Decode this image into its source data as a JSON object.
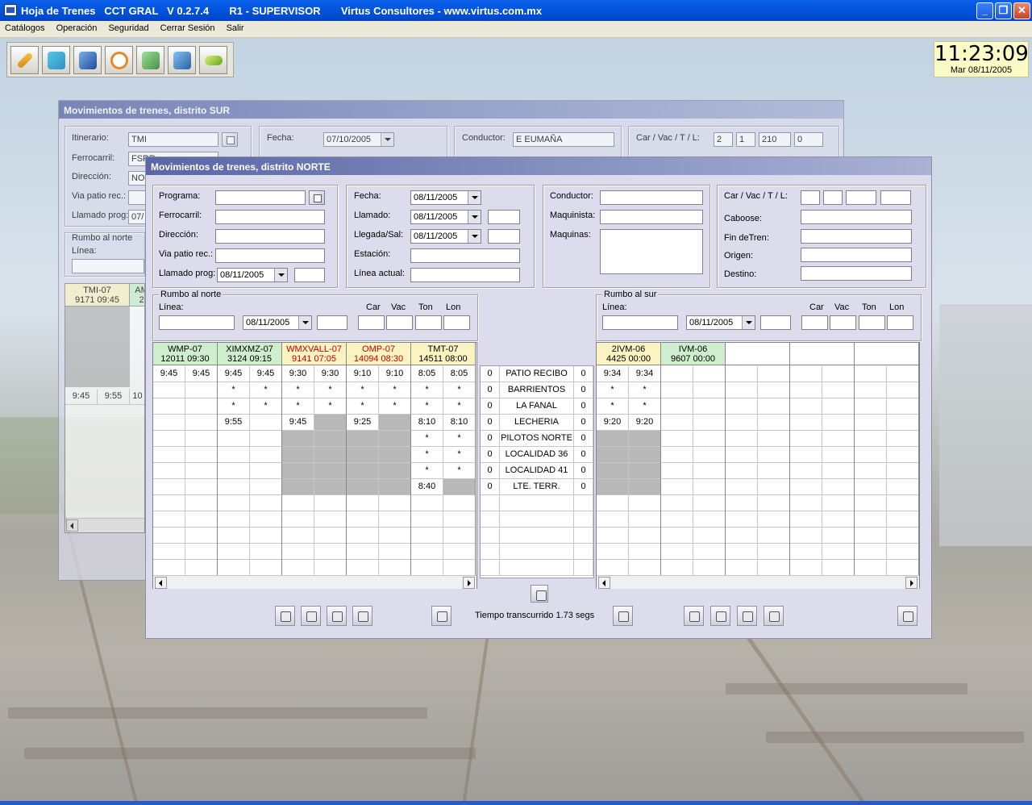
{
  "app": {
    "title": "Hoja de Trenes   CCT GRAL   V 0.2.7.4       R1 - SUPERVISOR       Virtus Consultores - www.virtus.com.mx"
  },
  "menu": [
    "Catálogos",
    "Operación",
    "Seguridad",
    "Cerrar Sesión",
    "Salir"
  ],
  "toolbar": [
    "pencil-icon",
    "export-icon",
    "books-icon",
    "clock-icon",
    "device-icon",
    "book-icon",
    "battery-icon"
  ],
  "clock": {
    "time": "11:23:09",
    "date": "Mar 08/11/2005"
  },
  "sur": {
    "title": "Movimientos de trenes, distrito SUR",
    "labels": {
      "itinerario": "Itinerario:",
      "ferrocarril": "Ferrocarril:",
      "direccion": "Dirección:",
      "via": "Via patio rec.:",
      "llamado_prog": "Llamado prog:",
      "fecha": "Fecha:",
      "conductor": "Conductor:",
      "car": "Car / Vac / T / L:",
      "rumbo": "Rumbo al norte",
      "linea": "Línea:"
    },
    "values": {
      "itinerario": "TMI",
      "ferrocarril": "FSRR",
      "direccion": "NO",
      "llamado_prog": "07/",
      "fecha": "07/10/2005",
      "conductor": "E EUMAÑA",
      "car": "2",
      "vac": "1",
      "ton": "210",
      "lon": "0"
    },
    "headers": [
      {
        "name": "TMI-07",
        "sub": "9171 09:45"
      },
      {
        "name": "AM",
        "sub": "2"
      }
    ],
    "row": [
      "9:45",
      "9:55",
      "10"
    ]
  },
  "norte": {
    "title": "Movimientos de trenes, distrito NORTE",
    "labels": {
      "programa": "Programa:",
      "ferrocarril": "Ferrocarril:",
      "direccion": "Dirección:",
      "via": "Via patio rec.:",
      "llamado_prog": "Llamado prog:",
      "fecha": "Fecha:",
      "llamado": "Llamado:",
      "llegada": "Llegada/Sal:",
      "estacion": "Estación:",
      "linea_actual": "Línea actual:",
      "conductor": "Conductor:",
      "maquinista": "Maquinista:",
      "maquinas": "Maquinas:",
      "car": "Car / Vac / T / L:",
      "caboose": "Caboose:",
      "fin_tren": "Fin deTren:",
      "origen": "Origen:",
      "destino": "Destino:",
      "rumbo_norte": "Rumbo al norte",
      "rumbo_sur": "Rumbo al sur",
      "linea": "Línea:",
      "car_h": "Car",
      "vac_h": "Vac",
      "ton_h": "Ton",
      "lon_h": "Lon"
    },
    "values": {
      "llamado_prog": "08/11/2005",
      "fecha": "08/11/2005",
      "llamado": "08/11/2005",
      "llegada": "08/11/2005",
      "norte_fecha": "08/11/2005",
      "sur_fecha": "08/11/2005"
    },
    "status": "Tiempo transcurrido 1.73 segs",
    "north_trains": [
      {
        "name": "WMP-07",
        "sub": "12011 09:30",
        "color": "#cfeecd",
        "text": "#000"
      },
      {
        "name": "XIMXMZ-07",
        "sub": "3124 09:15",
        "color": "#cfeecd",
        "text": "#000"
      },
      {
        "name": "WMXVALL-07",
        "sub": "9141 07:05",
        "color": "#fbf3c2",
        "text": "#c00000"
      },
      {
        "name": "OMP-07",
        "sub": "14094 08:30",
        "color": "#fbf3c2",
        "text": "#c00000"
      },
      {
        "name": "TMT-07",
        "sub": "14511 08:00",
        "color": "#fbf3c2",
        "text": "#000"
      }
    ],
    "north_rows": [
      [
        "9:45",
        "9:45",
        "9:45",
        "9:45",
        "9:30",
        "9:30",
        "9:10",
        "9:10",
        "8:05",
        "8:05"
      ],
      [
        "",
        "",
        "*",
        "*",
        "*",
        "*",
        "*",
        "*",
        "*",
        "*"
      ],
      [
        "",
        "",
        "*",
        "*",
        "*",
        "*",
        "*",
        "*",
        "*",
        "*"
      ],
      [
        "",
        "",
        "9:55",
        "",
        "9:45",
        "G",
        "9:25",
        "G",
        "8:10",
        "8:10"
      ],
      [
        "",
        "",
        "",
        "",
        "G",
        "G",
        "G",
        "G",
        "*",
        "*"
      ],
      [
        "",
        "",
        "",
        "",
        "G",
        "G",
        "G",
        "G",
        "*",
        "*"
      ],
      [
        "",
        "",
        "",
        "",
        "G",
        "G",
        "G",
        "G",
        "*",
        "*"
      ],
      [
        "",
        "",
        "",
        "",
        "G",
        "G",
        "G",
        "G",
        "8:40",
        "G"
      ]
    ],
    "stations": [
      {
        "l": "0",
        "name": "PATIO RECIBO",
        "r": "0"
      },
      {
        "l": "0",
        "name": "BARRIENTOS",
        "r": "0"
      },
      {
        "l": "0",
        "name": "LA FANAL",
        "r": "0"
      },
      {
        "l": "0",
        "name": "LECHERIA",
        "r": "0"
      },
      {
        "l": "0",
        "name": "PILOTOS NORTE",
        "r": "0"
      },
      {
        "l": "0",
        "name": "LOCALIDAD 36",
        "r": "0"
      },
      {
        "l": "0",
        "name": "LOCALIDAD 41",
        "r": "0"
      },
      {
        "l": "0",
        "name": "LTE. TERR.",
        "r": "0"
      }
    ],
    "south_trains": [
      {
        "name": "2IVM-06",
        "sub": "4425 00:00",
        "color": "#fbf3c2",
        "text": "#000"
      },
      {
        "name": "IVM-06",
        "sub": "9607 00:00",
        "color": "#cfeecd",
        "text": "#000"
      },
      {
        "name": "",
        "sub": "",
        "color": "#fff",
        "text": "#000"
      },
      {
        "name": "",
        "sub": "",
        "color": "#fff",
        "text": "#000"
      },
      {
        "name": "",
        "sub": "",
        "color": "#fff",
        "text": "#000"
      }
    ],
    "south_rows": [
      [
        "9:34",
        "9:34",
        "",
        "",
        "",
        "",
        "",
        "",
        "",
        ""
      ],
      [
        "*",
        "*",
        "",
        "",
        "",
        "",
        "",
        "",
        "",
        ""
      ],
      [
        "*",
        "*",
        "",
        "",
        "",
        "",
        "",
        "",
        "",
        ""
      ],
      [
        "9:20",
        "9:20",
        "",
        "",
        "",
        "",
        "",
        "",
        "",
        ""
      ],
      [
        "G",
        "G",
        "",
        "",
        "",
        "",
        "",
        "",
        "",
        ""
      ],
      [
        "G",
        "G",
        "",
        "",
        "",
        "",
        "",
        "",
        "",
        ""
      ],
      [
        "G",
        "G",
        "",
        "",
        "",
        "",
        "",
        "",
        "",
        ""
      ],
      [
        "G",
        "G",
        "",
        "",
        "",
        "",
        "",
        "",
        "",
        ""
      ]
    ]
  }
}
